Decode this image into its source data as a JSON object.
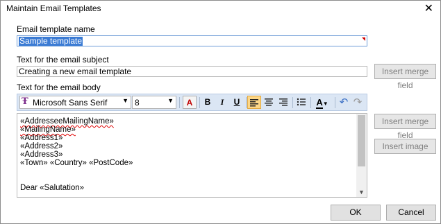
{
  "window": {
    "title": "Maintain Email Templates",
    "close_glyph": "✕"
  },
  "template_name": {
    "label": "Email template name",
    "value": "Sample template"
  },
  "subject": {
    "label": "Text for the email subject",
    "value": "Creating a new email template",
    "merge_button": "Insert merge field"
  },
  "body": {
    "label": "Text for the email body",
    "merge_button": "Insert merge field",
    "image_button": "Insert image",
    "lines": [
      [
        "«AddresseeMailingName»"
      ],
      [
        "«MailingName»"
      ],
      [
        "«Address1»"
      ],
      [
        "«Address2»"
      ],
      [
        "«Address3»"
      ],
      [
        "«Town» «Country» «PostCode»"
      ],
      [
        ""
      ],
      [
        ""
      ],
      [
        "Dear «Salutation»"
      ]
    ]
  },
  "toolbar": {
    "font_icon": "Ŧ",
    "font_name": "Microsoft Sans Serif",
    "font_size": "8",
    "color_text_icon": "A",
    "bold": "B",
    "italic": "I",
    "underline": "U",
    "font_color": "A",
    "undo_icon": "↶",
    "redo_icon": "↷"
  },
  "buttons": {
    "ok": "OK",
    "cancel": "Cancel"
  }
}
